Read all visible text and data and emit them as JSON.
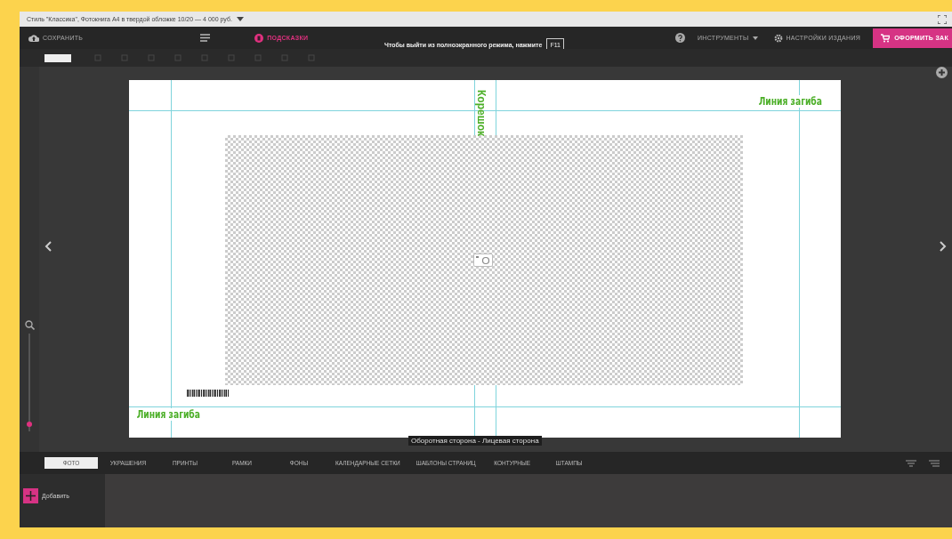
{
  "browser_bar": {
    "title": "Стиль \"Классика\", Фотокнига А4 в твердой обложке 10/20 — 4 000 руб."
  },
  "toolbar": {
    "save": "СОХРАНИТЬ",
    "hints": "ПОДСКАЗКИ",
    "fullscreen_hint": "Чтобы выйти из полноэкранного режима, нажмите",
    "fullscreen_key": "F11",
    "tools": "ИНСТРУМЕНТЫ",
    "settings": "НАСТРОЙКИ ИЗДАНИЯ",
    "order": "ОФОРМИТЬ ЗАК"
  },
  "zoom": {
    "level": 0.05
  },
  "page": {
    "fold_labels": [
      "Линия загиба",
      "Линия загиба"
    ],
    "spine_label": "Корешок"
  },
  "page_caption": "Оборотная сторона - Лицевая сторона",
  "tabs": [
    {
      "label": "ФОТО",
      "selected": true
    },
    {
      "label": "УКРАШЕНИЯ",
      "selected": false
    },
    {
      "label": "ПРИНТЫ",
      "selected": false
    },
    {
      "label": "РАМКИ",
      "selected": false
    },
    {
      "label": "ФОНЫ",
      "selected": false
    },
    {
      "label": "КАЛЕНДАРНЫЕ СЕТКИ",
      "selected": false
    },
    {
      "label": "ШАБЛОНЫ СТРАНИЦ",
      "selected": false
    },
    {
      "label": "КОНТУРНЫЕ",
      "selected": false
    },
    {
      "label": "ШТАМПЫ",
      "selected": false
    }
  ],
  "panel": {
    "add": "Добавить"
  }
}
